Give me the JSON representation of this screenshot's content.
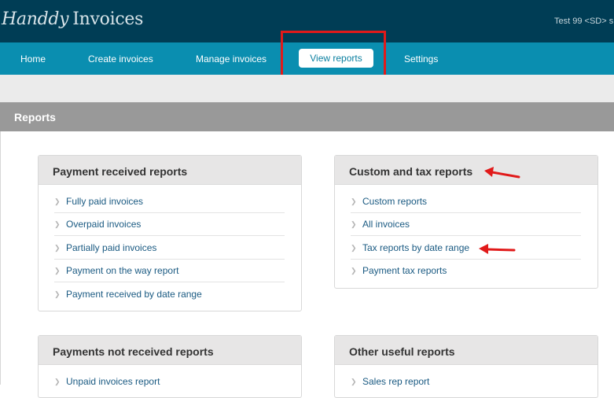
{
  "header": {
    "logo_part1": "Handdy",
    "logo_part2": "Invoices",
    "user_text": "Test 99 <SD> s"
  },
  "nav": {
    "items": [
      "Home",
      "Create invoices",
      "Manage invoices",
      "View reports",
      "Settings"
    ],
    "active": "View reports"
  },
  "reports": {
    "title": "Reports",
    "panels": [
      {
        "title": "Payment received reports",
        "links": [
          "Fully paid invoices",
          "Overpaid invoices",
          "Partially paid invoices",
          "Payment on the way report",
          "Payment received by date range"
        ]
      },
      {
        "title": "Custom and tax reports",
        "links": [
          "Custom reports",
          "All invoices",
          "Tax reports by date range",
          "Payment tax reports"
        ]
      },
      {
        "title": "Payments not received reports",
        "links": [
          "Unpaid invoices report"
        ]
      },
      {
        "title": "Other useful reports",
        "links": [
          "Sales rep report"
        ]
      }
    ]
  },
  "colors": {
    "header_bg": "#003d55",
    "nav_bg": "#0a8eb0",
    "link": "#1a5a82",
    "annotation_red": "#e11a1a",
    "section_head_bg": "#999999"
  },
  "icons": {
    "link_bullet": "chevron-right-icon",
    "annotation": "red-arrow-icon"
  }
}
